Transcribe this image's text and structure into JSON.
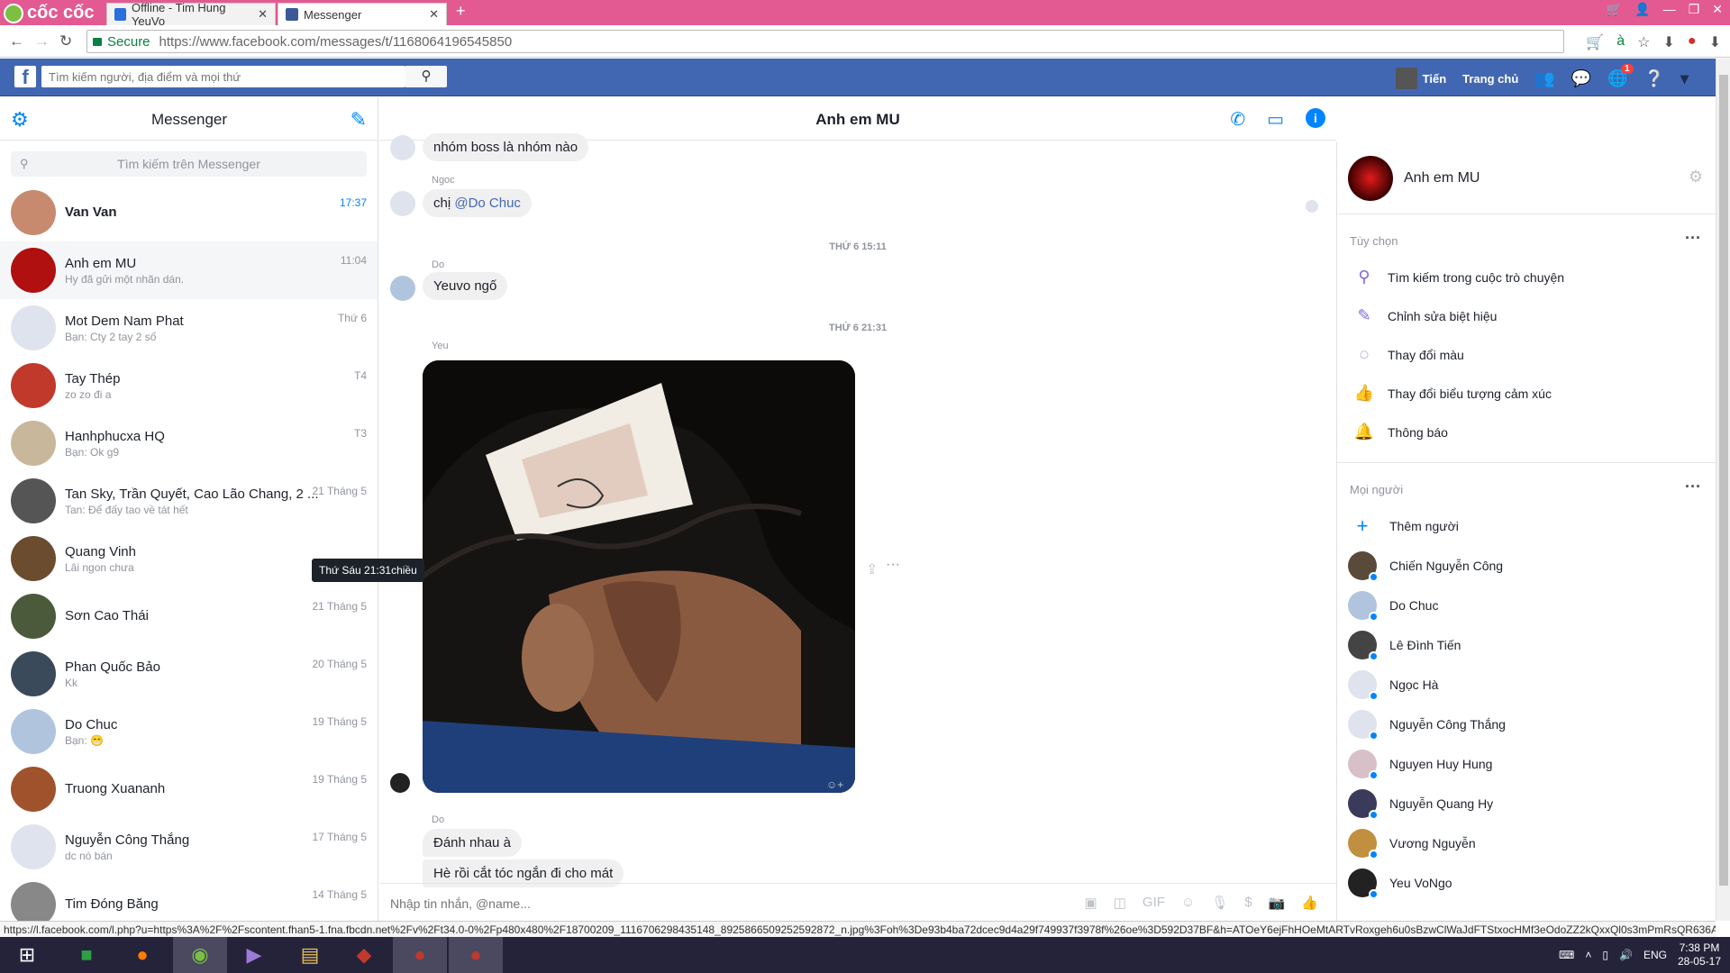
{
  "browser": {
    "brand": "cốc cốc",
    "tabs": [
      {
        "label": "Offline - Tim Hung YeuVo"
      },
      {
        "label": "Messenger"
      }
    ],
    "new_tab": "+",
    "secure_label": "Secure",
    "url_domain": "https://www.facebook.com",
    "url_path": "/messages/t/1168064196545850"
  },
  "fb": {
    "search_placeholder": "Tìm kiếm người, địa điểm và mọi thứ",
    "user_name": "Tiến",
    "home_label": "Trang chủ",
    "notif_count": "1"
  },
  "sidebar": {
    "title": "Messenger",
    "search_placeholder": "Tìm kiếm trên Messenger",
    "conversations": [
      {
        "name": "Van Van",
        "snippet": "",
        "time": "17:37",
        "color": "#c88a6e"
      },
      {
        "name": "Anh em MU",
        "snippet": "Hy đã gửi một nhãn dán.",
        "time": "11:04",
        "color": "#b01010"
      },
      {
        "name": "Mot Dem Nam Phat",
        "snippet": "Bạn: Cty 2 tay 2 số",
        "time": "Thứ 6",
        "color": "#dfe3ee"
      },
      {
        "name": "Tay Thép",
        "snippet": "zo zo đi a",
        "time": "T4",
        "color": "#c0392b"
      },
      {
        "name": "Hanhphucxa HQ",
        "snippet": "Bạn: Ok g9",
        "time": "T3",
        "color": "#c9b79c"
      },
      {
        "name": "Tan Sky, Trần Quyết, Cao Lão Chang, 2 ...",
        "snippet": "Tan: Để đấy tao về tát hết",
        "time": "21 Tháng 5",
        "color": "#555555"
      },
      {
        "name": "Quang Vinh",
        "snippet": "Lâi ngon chưa",
        "time": "",
        "color": "#6b4c2e"
      },
      {
        "name": "Sơn Cao Thái",
        "snippet": "",
        "time": "21 Tháng 5",
        "color": "#4a5a3a"
      },
      {
        "name": "Phan Quốc Bảo",
        "snippet": "Kk",
        "time": "20 Tháng 5",
        "color": "#3a4a5a"
      },
      {
        "name": "Do Chuc",
        "snippet": "Bạn: 😁",
        "time": "19 Tháng 5",
        "color": "#b0c4de"
      },
      {
        "name": "Truong Xuananh",
        "snippet": "",
        "time": "19 Tháng 5",
        "color": "#a0522d"
      },
      {
        "name": "Nguyễn Công Thắng",
        "snippet": "dc nó bán",
        "time": "17 Tháng 5",
        "color": "#dfe3ee"
      },
      {
        "name": "Tim Đóng Băng",
        "snippet": "",
        "time": "14 Tháng 5",
        "color": "#888888"
      }
    ]
  },
  "chat": {
    "title": "Anh em MU",
    "messages": {
      "m1": "nhóm boss là nhóm nào",
      "sender_ngoc": "Ngoc",
      "m2_prefix": "chị ",
      "m2_mention": "@Do Chuc",
      "ts1": "THỨ 6 15:11",
      "sender_do": "Do",
      "m3": "Yeuvo ngố",
      "ts2": "THỨ 6 21:31",
      "sender_yeu": "Yeu",
      "tooltip": "Thứ Sáu 21:31chiều",
      "sender_do2": "Do",
      "m4": "Đánh nhau à",
      "m5": "Hè rồi cắt tóc ngắn đi cho mát"
    },
    "composer_placeholder": "Nhập tin nhắn, @name..."
  },
  "details": {
    "group_name": "Anh em MU",
    "options_title": "Tùy chọn",
    "options": [
      {
        "label": "Tìm kiếm trong cuộc trò chuyện",
        "icon": "search-icon"
      },
      {
        "label": "Chỉnh sửa biệt hiệu",
        "icon": "pencil-icon"
      },
      {
        "label": "Thay đổi màu",
        "icon": "palette-icon"
      },
      {
        "label": "Thay đổi biểu tượng cảm xúc",
        "icon": "thumbs-up-icon"
      },
      {
        "label": "Thông báo",
        "icon": "bell-icon"
      }
    ],
    "people_title": "Mọi người",
    "add_person": "Thêm người",
    "people": [
      {
        "name": "Chiến Nguyễn Công",
        "color": "#5a4a3a"
      },
      {
        "name": "Do Chuc",
        "color": "#b0c4de"
      },
      {
        "name": "Lê Đình Tiến",
        "color": "#444444"
      },
      {
        "name": "Ngọc Hà",
        "color": "#dfe3ee"
      },
      {
        "name": "Nguyễn Công Thắng",
        "color": "#dfe3ee"
      },
      {
        "name": "Nguyen Huy Hung",
        "color": "#d8c0c8"
      },
      {
        "name": "Nguyễn Quang Hy",
        "color": "#3a3a5a"
      },
      {
        "name": "Vương Nguyễn",
        "color": "#c09040"
      },
      {
        "name": "Yeu VoNgo",
        "color": "#222222"
      }
    ]
  },
  "status_url": "https://l.facebook.com/l.php?u=https%3A%2F%2Fscontent.fhan5-1.fna.fbcdn.net%2Fv%2Ft34.0-0%2Fp480x480%2F18700209_1116706298435148_8925866509252592872_n.jpg%3Foh%3De93b4ba72dcec9d4a29f749937f3978f%26oe%3D592D37BF&h=ATOeY6ejFhHOeMtARTvRoxgeh6u0sBzwClWaJdFTStxocHMf3eOdoZZ2kQxxQl0s3mPmRsQR636AvRrN2g...",
  "taskbar": {
    "lang": "ENG",
    "time": "7:38 PM",
    "date": "28-05-17"
  },
  "colors": {
    "accent": "#0084ff",
    "fb_blue": "#4267b2",
    "tab_pink": "#e35a92"
  }
}
